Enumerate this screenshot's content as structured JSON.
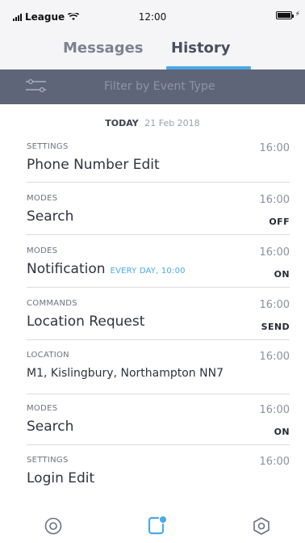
{
  "status_bar": {
    "carrier": "League",
    "time": "12:00"
  },
  "tabs": [
    {
      "label": "Messages",
      "active": false
    },
    {
      "label": "History",
      "active": true
    }
  ],
  "filter": {
    "placeholder": "Filter by Event Type"
  },
  "date_header": {
    "label": "TODAY",
    "date": "21 Feb 2018"
  },
  "events": [
    {
      "category": "SETTINGS",
      "title": "Phone Number Edit",
      "time": "16:00"
    },
    {
      "category": "MODES",
      "title": "Search",
      "time": "16:00",
      "status": "OFF"
    },
    {
      "category": "MODES",
      "title": "Notification",
      "schedule": "EVERY DAY, 10:00",
      "time": "16:00",
      "status": "ON"
    },
    {
      "category": "COMMANDS",
      "title": "Location Request",
      "time": "16:00",
      "status": "SEND"
    },
    {
      "category": "LOCATION",
      "title": "M1, Kislingbury, Northampton NN7",
      "time": "16:00"
    },
    {
      "category": "MODES",
      "title": "Search",
      "time": "16:00",
      "status": "ON"
    },
    {
      "category": "SETTINGS",
      "title": "Login Edit",
      "time": "16:00"
    }
  ],
  "bottom_nav": [
    {
      "icon": "target-icon"
    },
    {
      "icon": "messages-icon"
    },
    {
      "icon": "hexagon-settings-icon"
    }
  ],
  "colors": {
    "accent": "#4aa9e9",
    "filter_bar": "#5e6578",
    "header_bg": "#f5f5f7"
  }
}
